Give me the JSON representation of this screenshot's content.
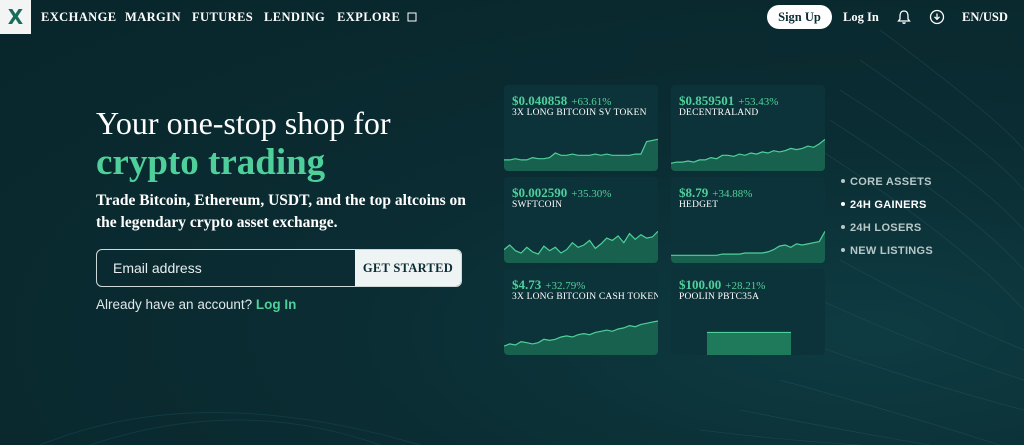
{
  "nav": {
    "logo": "X",
    "items": [
      "EXCHANGE",
      "MARGIN",
      "FUTURES",
      "LENDING",
      "EXPLORE"
    ],
    "explore_icon": "external-link-icon",
    "signup": "Sign Up",
    "login": "Log In",
    "bell_icon": "bell-icon",
    "download_icon": "download-icon",
    "locale": "EN/USD"
  },
  "hero": {
    "title": "Your one-stop shop for",
    "accent": "crypto trading",
    "subtitle": "Trade Bitcoin, Ethereum, USDT, and the top altcoins on the legendary crypto asset exchange.",
    "email_placeholder": "Email address",
    "cta": "GET STARTED",
    "account_prompt": "Already have an account?",
    "login_link": "Log In"
  },
  "cards": [
    {
      "price": "$0.040858",
      "change": "+63.61%",
      "name": "3X LONG BITCOIN SV TOKEN",
      "spark": [
        8,
        8,
        9,
        8,
        8,
        10,
        9,
        9,
        10,
        14,
        12,
        12,
        13,
        12,
        12,
        12,
        13,
        12,
        13,
        12,
        12,
        12,
        12,
        13,
        13,
        24,
        25,
        26
      ]
    },
    {
      "price": "$0.859501",
      "change": "+53.43%",
      "name": "DECENTRALAND",
      "spark": [
        5,
        6,
        6,
        7,
        6,
        8,
        8,
        10,
        9,
        12,
        12,
        11,
        13,
        12,
        14,
        13,
        15,
        14,
        16,
        15,
        16,
        18,
        17,
        18,
        20,
        19,
        22,
        26
      ]
    },
    {
      "price": "$0.002590",
      "change": "+35.30%",
      "name": "SWFTCOIN",
      "spark": [
        10,
        14,
        9,
        7,
        12,
        8,
        6,
        13,
        9,
        12,
        7,
        10,
        16,
        12,
        14,
        18,
        11,
        15,
        20,
        18,
        22,
        16,
        24,
        19,
        23,
        20,
        21,
        26
      ]
    },
    {
      "price": "$8.79",
      "change": "+34.88%",
      "name": "HEDGET",
      "spark": [
        5,
        5,
        5,
        5,
        5,
        5,
        5,
        5,
        5,
        6,
        6,
        6,
        6,
        7,
        7,
        7,
        7,
        8,
        10,
        13,
        14,
        12,
        15,
        14,
        15,
        16,
        17,
        26
      ]
    },
    {
      "price": "$4.73",
      "change": "+32.79%",
      "name": "3X LONG BITCOIN CASH TOKEN",
      "spark": [
        6,
        8,
        7,
        10,
        9,
        8,
        9,
        12,
        11,
        12,
        14,
        15,
        14,
        16,
        17,
        16,
        18,
        19,
        20,
        19,
        21,
        22,
        24,
        23,
        25,
        26,
        27,
        28
      ]
    },
    {
      "price": "$100.00",
      "change": "+28.21%",
      "name": "POOLIN PBTC35A",
      "spark": [
        0,
        0,
        0,
        0,
        0,
        0,
        0,
        0,
        0,
        0,
        18,
        18,
        18,
        18,
        18,
        18,
        18,
        18,
        18,
        18,
        18,
        18,
        18,
        18,
        0,
        0,
        0,
        0
      ]
    }
  ],
  "categories": [
    "CORE ASSETS",
    "24H GAINERS",
    "24H LOSERS",
    "NEW LISTINGS"
  ],
  "active_category": "24H GAINERS",
  "colors": {
    "background": "#0a2c32",
    "accent": "#4fd09b",
    "card": "#0c3339"
  }
}
